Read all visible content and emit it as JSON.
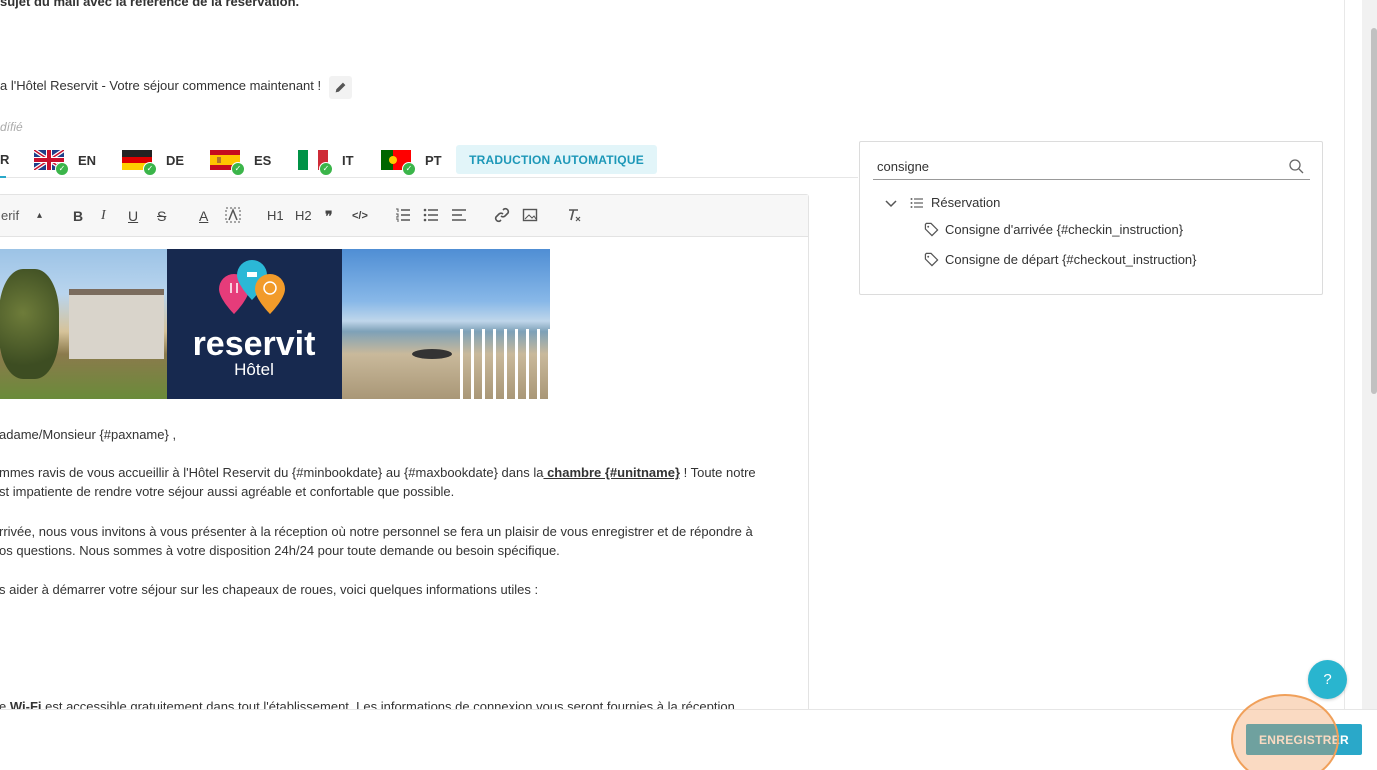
{
  "top": {
    "note": "sujet du mail avec la référence de la réservation.",
    "subject": "a l'Hôtel Reservit - Votre séjour commence maintenant !",
    "modified": "dífié"
  },
  "tabs": [
    {
      "code": "R"
    },
    {
      "code": "EN",
      "flag": "uk-flag-icon"
    },
    {
      "code": "DE",
      "flag": "germany-flag-icon"
    },
    {
      "code": "ES",
      "flag": "spain-flag-icon"
    },
    {
      "code": "IT",
      "flag": "italy-flag-icon"
    },
    {
      "code": "PT",
      "flag": "portugal-flag-icon"
    }
  ],
  "auto_translate_label": "TRADUCTION AUTOMATIQUE",
  "toolbar": {
    "font": "erif",
    "buttons": [
      "B",
      "I",
      "U",
      "S",
      "A",
      "H1",
      "H2",
      "❞",
      "</>"
    ]
  },
  "banner": {
    "brand": "reservit",
    "sub": "Hôtel"
  },
  "content": {
    "greeting": "adame/Monsieur {#paxname} ,",
    "p1_line1_a": "mmes ravis de vous accueillir à l'Hôtel Reservit  du {#minbookdate} au {#maxbookdate} dans la",
    "p1_link": " chambre {#unitname}",
    "p1_line1_b": " ! Toute notre",
    "p1_line2": "st impatiente de rendre votre séjour aussi agréable et confortable que possible.",
    "p2_line1": "rrivée, nous vous invitons à vous présenter à la réception où notre personnel se fera un plaisir de vous enregistrer et de répondre à",
    "p2_line2": "os questions. Nous sommes à votre disposition 24h/24 pour toute demande ou besoin spécifique.",
    "p3": "s aider à démarrer votre séjour sur les chapeaux de roues, voici quelques informations utiles :",
    "p4_a": "e ",
    "p4_bold": "Wi-Fi",
    "p4_b": " est accessible gratuitement dans tout l'établissement. Les informations de connexion vous seront fournies à la réception"
  },
  "panel": {
    "search_value": "consigne",
    "group": "Réservation",
    "items": [
      "Consigne d'arrivée {#checkin_instruction}",
      "Consigne de départ {#checkout_instruction}"
    ]
  },
  "help_label": "?",
  "save_label": "ENREGISTRER",
  "colors": {
    "accent": "#2aa8c9",
    "auto_btn_bg": "#e2f5f9",
    "check": "#3bb54a",
    "logo_bg": "#17294f",
    "highlight": "#f0a05a"
  }
}
